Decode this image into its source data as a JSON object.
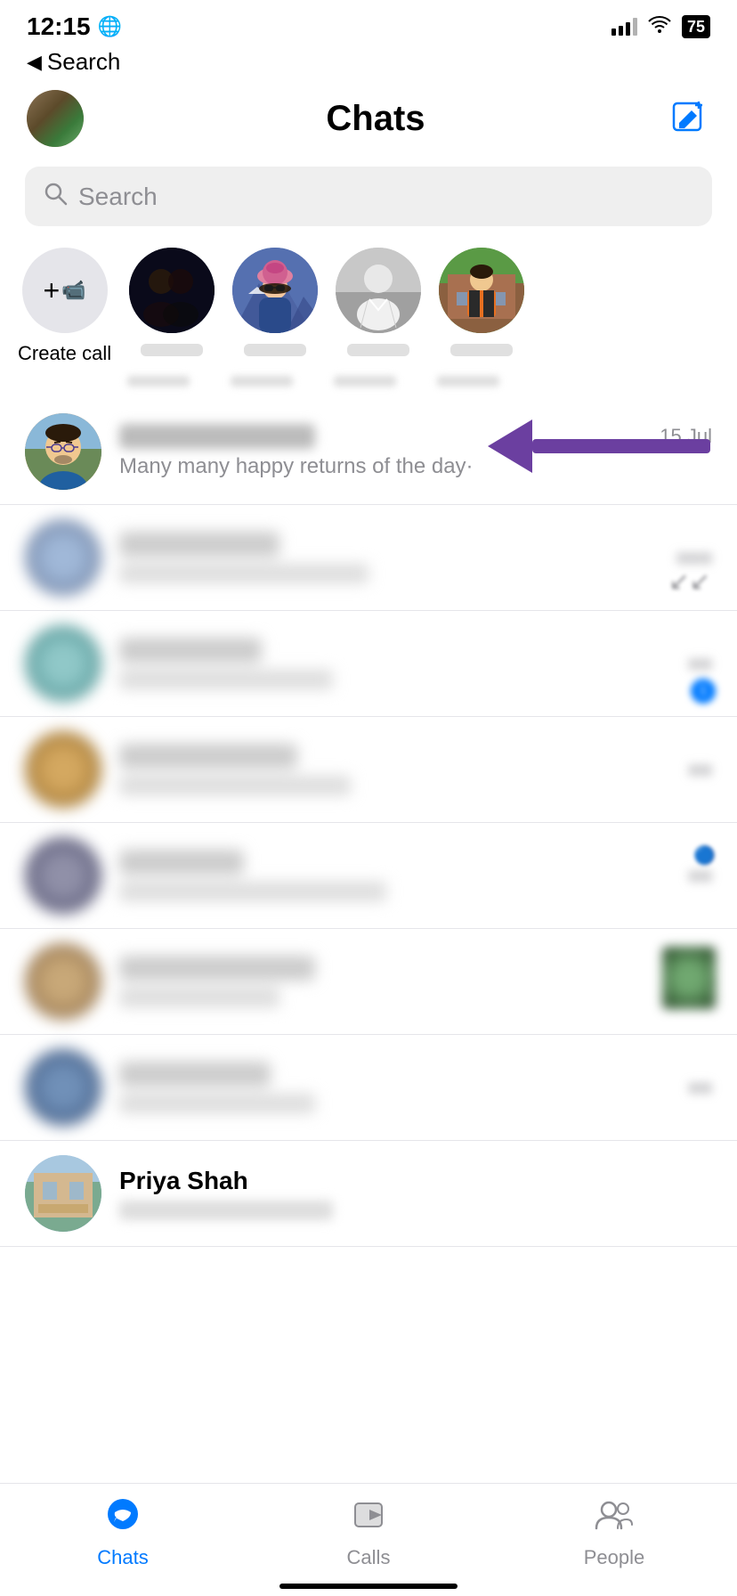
{
  "statusBar": {
    "time": "12:15",
    "globe": "🌐",
    "battery": "75"
  },
  "navBack": {
    "label": "Search"
  },
  "header": {
    "title": "Chats",
    "composeLabel": "compose"
  },
  "searchBar": {
    "placeholder": "Search"
  },
  "createCall": {
    "label": "Create\ncall"
  },
  "firstChat": {
    "preview": "Many many happy returns of the day·",
    "time": "15 Jul"
  },
  "bottomNav": {
    "chats": "Chats",
    "calls": "Calls",
    "people": "People"
  },
  "partialChat": {
    "name": "Priya Shah"
  }
}
